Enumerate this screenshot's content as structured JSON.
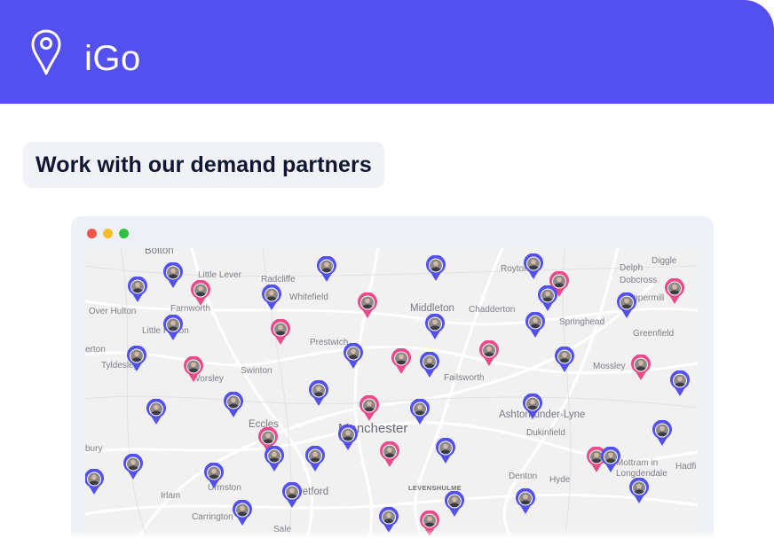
{
  "header": {
    "brand": "iGo",
    "logo_icon": "location-pin-icon",
    "background_color": "#5450ef"
  },
  "section": {
    "title": "Work with our demand partners"
  },
  "window": {
    "controls": [
      {
        "name": "close",
        "color": "#f1544c"
      },
      {
        "name": "minimize",
        "color": "#f8bd2d"
      },
      {
        "name": "maximize",
        "color": "#2dc442"
      }
    ]
  },
  "map": {
    "places": [
      {
        "label": "Bolton"
      },
      {
        "label": "Little Lever"
      },
      {
        "label": "Radcliffe"
      },
      {
        "label": "Whitefield"
      },
      {
        "label": "Royton"
      },
      {
        "label": "Delph"
      },
      {
        "label": "Diggle"
      },
      {
        "label": "Dobcross"
      },
      {
        "label": "Uppermill"
      },
      {
        "label": "Over Hulton"
      },
      {
        "label": "Farnworth"
      },
      {
        "label": "Middleton"
      },
      {
        "label": "Chadderton"
      },
      {
        "label": "Springhead"
      },
      {
        "label": "Little Hulton"
      },
      {
        "label": "Greenfield"
      },
      {
        "label": "Prestwich"
      },
      {
        "label": "erton"
      },
      {
        "label": "Tyldesley"
      },
      {
        "label": "Swinton"
      },
      {
        "label": "Worsley"
      },
      {
        "label": "Failsworth"
      },
      {
        "label": "Mossley"
      },
      {
        "label": "Ashton-under-Lyne"
      },
      {
        "label": "Eccles"
      },
      {
        "label": "Manchester"
      },
      {
        "label": "Dukinfield"
      },
      {
        "label": "bury"
      },
      {
        "label": "Mottram in"
      },
      {
        "label": "Longdendale"
      },
      {
        "label": "Hadfi"
      },
      {
        "label": "Denton"
      },
      {
        "label": "Hyde"
      },
      {
        "label": "Urmston"
      },
      {
        "label": "LEVENSHULME"
      },
      {
        "label": "Stretford"
      },
      {
        "label": "Irlam"
      },
      {
        "label": "Carrington"
      },
      {
        "label": "Sale"
      }
    ],
    "marker_colors": {
      "supply": "#5450ef",
      "demand": "#ea4c8a"
    },
    "marker_icon": "avatar-map-pin-icon"
  }
}
